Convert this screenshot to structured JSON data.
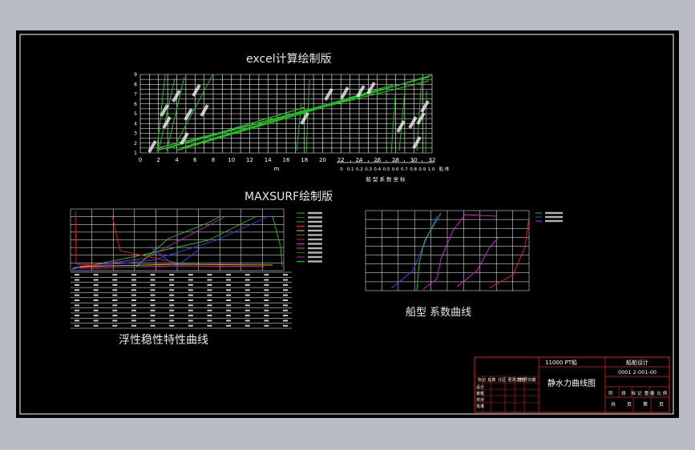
{
  "titles": {
    "excel": "excel计算绘制版",
    "maxsurf": "MAXSURF绘制版",
    "floating": "浮性稳性特性曲线",
    "coeff": "船型 系数曲线"
  },
  "excel_chart": {
    "x_ticks": [
      "0",
      "2",
      "4",
      "6",
      "8",
      "10",
      "12",
      "14",
      "16",
      "18",
      "20",
      "22",
      "24",
      "26",
      "28",
      "30",
      "32"
    ],
    "y_ticks": [
      "1",
      "2",
      "3",
      "4",
      "5",
      "6",
      "7",
      "8",
      "9"
    ],
    "x_label": "m",
    "coef_ticks": [
      "0",
      "0.1",
      "0.2",
      "0.3",
      "0.4",
      "0.5",
      "0.6",
      "0.7",
      "0.8",
      "0.9",
      "1.0"
    ],
    "coef_unit": "船 体",
    "coef_label": "船 型 系 数 坐 标"
  },
  "title_block": {
    "ship": "11000 PT船",
    "stage": "船舶设计",
    "code": "0001 2-001-00",
    "drawing": "静水力曲线图",
    "labels": [
      "标记",
      "处数",
      "分区",
      "更改文件号",
      "签名",
      "日期"
    ],
    "small": [
      "设计",
      "审核",
      "校对",
      "批准"
    ],
    "stage_row": [
      "阶",
      "段",
      "标 记",
      "重 量",
      "比 例"
    ],
    "sheet_row": [
      "共",
      "页",
      "第",
      "页"
    ]
  },
  "colors": {
    "background": "#000000",
    "outer": "#b9bcc5",
    "grid": "#ffffff",
    "green": "#22c022",
    "red": "#e02020",
    "blue": "#3344ff",
    "magenta": "#d020d0",
    "yellow": "#e0d000"
  }
}
